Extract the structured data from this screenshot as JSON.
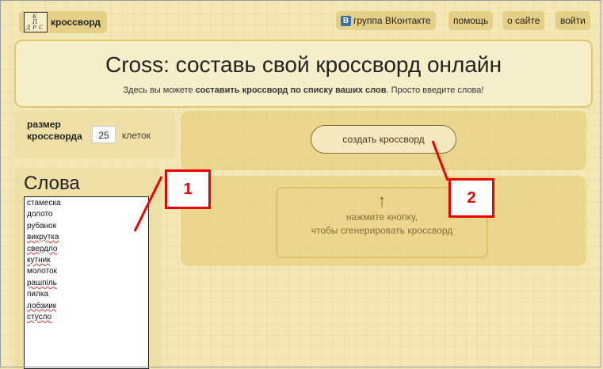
{
  "logo": {
    "text": "кроссворд"
  },
  "nav": {
    "vk_badge": "B",
    "vk_label": "группа ВКонтакте",
    "help": "помощь",
    "about": "о сайте",
    "login": "войти"
  },
  "header": {
    "title": "Cross: составь свой кроссворд онлайн",
    "subtitle_pre": "Здесь вы можете ",
    "subtitle_bold": "составить кроссворд по списку ваших слов",
    "subtitle_post": ". Просто введите слова!"
  },
  "size": {
    "label": "размер кроссворда",
    "value": "25",
    "unit": "клеток"
  },
  "words": {
    "title": "Слова",
    "items": [
      {
        "text": "стамеска",
        "err": false
      },
      {
        "text": "долото",
        "err": false
      },
      {
        "text": "рубанок",
        "err": false
      },
      {
        "text": "викрутка",
        "err": true
      },
      {
        "text": "свердло",
        "err": true
      },
      {
        "text": "кутник",
        "err": true
      },
      {
        "text": "молоток",
        "err": false
      },
      {
        "text": "рашпіль",
        "err": true
      },
      {
        "text": "пилка",
        "err": false
      },
      {
        "text": "лобзиик",
        "err": true
      },
      {
        "text": "стусло",
        "err": true
      }
    ]
  },
  "main": {
    "create_label": "создать кроссворд",
    "arrow": "↑",
    "hint_line1": "нажмите кнопку,",
    "hint_line2": "чтобы сгенерировать кроссворд"
  },
  "annotations": {
    "one": "1",
    "two": "2"
  },
  "colors": {
    "background": "#f3e7b5",
    "accent": "#e0c56f",
    "callout": "#e00000"
  }
}
